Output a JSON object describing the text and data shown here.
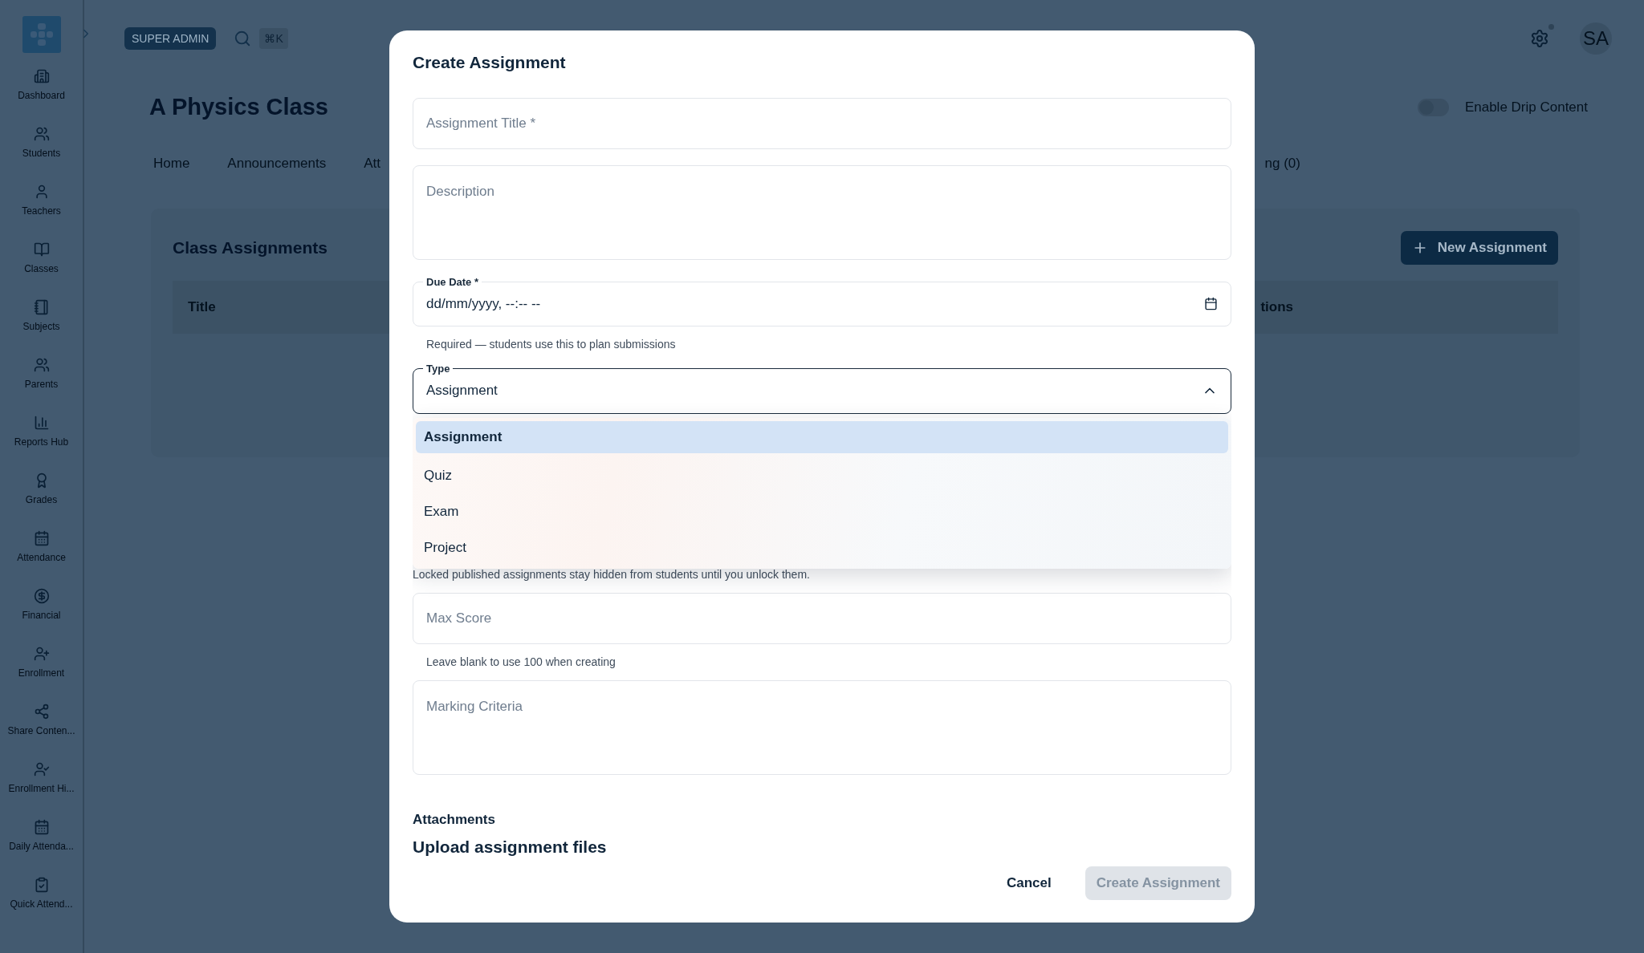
{
  "sidebar": {
    "items": [
      {
        "label": "Dashboard"
      },
      {
        "label": "Students"
      },
      {
        "label": "Teachers"
      },
      {
        "label": "Classes"
      },
      {
        "label": "Subjects"
      },
      {
        "label": "Parents"
      },
      {
        "label": "Reports Hub"
      },
      {
        "label": "Grades"
      },
      {
        "label": "Attendance"
      },
      {
        "label": "Financial"
      },
      {
        "label": "Enrollment"
      },
      {
        "label": "Share Conten..."
      },
      {
        "label": "Enrollment Hi..."
      },
      {
        "label": "Daily Attenda..."
      },
      {
        "label": "Quick Attend..."
      }
    ]
  },
  "topbar": {
    "role_badge": "SUPER ADMIN",
    "shortcut": "⌘K",
    "avatar": "SA"
  },
  "page": {
    "title": "A Physics Class",
    "drip_toggle": {
      "label": "Enable Drip Content",
      "on": false
    },
    "tabs": [
      {
        "label": "Home"
      },
      {
        "label": "Announcements"
      },
      {
        "label": "Att"
      },
      {
        "label": "ng (0)"
      }
    ],
    "card": {
      "title": "Class Assignments",
      "new_button": "New Assignment",
      "columns": [
        "Title",
        "tions"
      ]
    }
  },
  "dialog": {
    "title": "Create Assignment",
    "fields": [
      {
        "kind": "text",
        "placeholder": "Assignment Title *"
      },
      {
        "kind": "textarea",
        "placeholder": "Description"
      },
      {
        "kind": "date",
        "label": "Due Date *",
        "value": "dd/mm/yyyy, --:-- --",
        "helper": "Required — students use this to plan submissions"
      },
      {
        "kind": "select",
        "label": "Type",
        "value": "Assignment",
        "expanded": true,
        "options": [
          {
            "label": "Assignment",
            "selected": true
          },
          {
            "label": "Quiz",
            "selected": false
          },
          {
            "label": "Exam",
            "selected": false
          },
          {
            "label": "Project",
            "selected": false
          }
        ]
      },
      {
        "kind": "note",
        "text": "Locked published assignments stay hidden from students until you unlock them."
      },
      {
        "kind": "text",
        "placeholder": "Max Score",
        "helper": "Leave blank to use 100 when creating"
      },
      {
        "kind": "textarea",
        "placeholder": "Marking Criteria"
      }
    ],
    "attachments": {
      "heading": "Attachments",
      "subheading": "Upload assignment files"
    },
    "buttons": [
      {
        "label": "Cancel",
        "kind": "text",
        "disabled": false
      },
      {
        "label": "Create Assignment",
        "kind": "primary",
        "disabled": true
      }
    ]
  }
}
